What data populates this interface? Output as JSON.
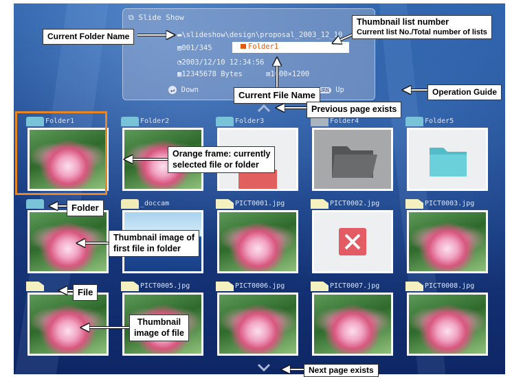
{
  "panel": {
    "title": "Slide Show",
    "folder_path": "\\slideshow\\design\\proposal_2003_12_10",
    "list_number": "001/345",
    "current_file": "Folder1",
    "date": "2003/12/10 12:34:56",
    "size": "12345678 Bytes",
    "resolution": "1600×1200",
    "guide_down": "Down",
    "guide_return": "RETURN",
    "guide_up": "Up"
  },
  "items": [
    {
      "name": "Folder1",
      "kind": "folder",
      "thumb": "lotus"
    },
    {
      "name": "Folder2",
      "kind": "folder",
      "thumb": "lotus"
    },
    {
      "name": "Folder3",
      "kind": "folder",
      "thumb": "folder-red"
    },
    {
      "name": "Folder4",
      "kind": "folder",
      "thumb": "folder-dark"
    },
    {
      "name": "Folder5",
      "kind": "folder",
      "thumb": "folder-cyan"
    },
    {
      "name": "",
      "kind": "folder",
      "thumb": "lotus"
    },
    {
      "name": "_doccam",
      "kind": "doccam",
      "thumb": "sky"
    },
    {
      "name": "PICT0001.jpg",
      "kind": "file",
      "thumb": "lotus"
    },
    {
      "name": "PICT0002.jpg",
      "kind": "file",
      "thumb": "error"
    },
    {
      "name": "PICT0003.jpg",
      "kind": "file",
      "thumb": "lotus"
    },
    {
      "name": "",
      "kind": "file",
      "thumb": "lotus"
    },
    {
      "name": "PICT0005.jpg",
      "kind": "file",
      "thumb": "lotus"
    },
    {
      "name": "PICT0006.jpg",
      "kind": "file",
      "thumb": "lotus"
    },
    {
      "name": "PICT0007.jpg",
      "kind": "file",
      "thumb": "lotus"
    },
    {
      "name": "PICT0008.jpg",
      "kind": "file",
      "thumb": "lotus"
    }
  ],
  "callouts": {
    "current_folder_name": "Current Folder Name",
    "thumbnail_list_number_title": "Thumbnail list number",
    "thumbnail_list_number_sub": "Current list No./Total number of lists",
    "current_file_name": "Current File Name",
    "operation_guide": "Operation Guide",
    "previous_page": "Previous page exists",
    "orange_frame_line1": "Orange frame: currently",
    "orange_frame_line2": "selected file or folder",
    "folder": "Folder",
    "thumb_first_line1": "Thumbnail image of",
    "thumb_first_line2": "first file in folder",
    "file": "File",
    "thumb_file_line1": "Thumbnail",
    "thumb_file_line2": "image of file",
    "next_page": "Next page exists"
  },
  "colors": {
    "selection_frame": "#e88525",
    "current_file_text": "#e05b10",
    "background_blue": "#1a3f86"
  }
}
